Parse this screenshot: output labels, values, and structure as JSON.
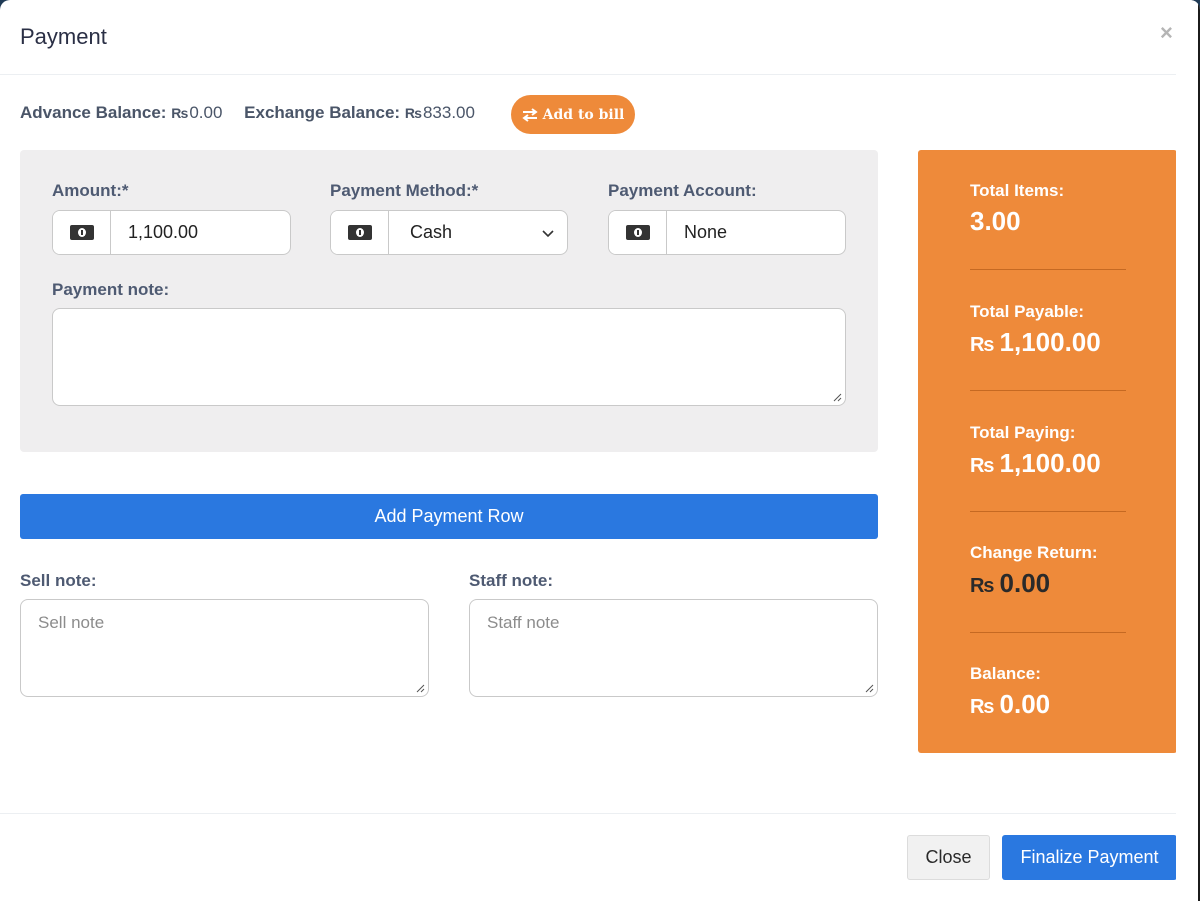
{
  "modal": {
    "title": "Payment"
  },
  "balances": {
    "advance_label": "Advance Balance:",
    "advance_currency": "₨",
    "advance_value": "0.00",
    "exchange_label": "Exchange Balance:",
    "exchange_currency": "₨",
    "exchange_value": "833.00",
    "add_to_bill_label": "Add to bill"
  },
  "payment_row": {
    "amount_label": "Amount:*",
    "amount_value": "1,100.00",
    "method_label": "Payment Method:*",
    "method_value": "Cash",
    "account_label": "Payment Account:",
    "account_value": "None",
    "note_label": "Payment note:",
    "note_value": ""
  },
  "add_payment_row_label": "Add Payment Row",
  "notes": {
    "sell_label": "Sell note:",
    "sell_placeholder": "Sell note",
    "staff_label": "Staff note:",
    "staff_placeholder": "Staff note"
  },
  "summary": {
    "currency": "₨",
    "total_items_label": "Total Items:",
    "total_items_value": "3.00",
    "total_payable_label": "Total Payable:",
    "total_payable_value": "1,100.00",
    "total_paying_label": "Total Paying:",
    "total_paying_value": "1,100.00",
    "change_return_label": "Change Return:",
    "change_return_value": "0.00",
    "balance_label": "Balance:",
    "balance_value": "0.00"
  },
  "footer": {
    "close_label": "Close",
    "finalize_label": "Finalize Payment"
  },
  "colors": {
    "accent_orange": "#ee8a3a",
    "primary_blue": "#2a78e0"
  },
  "icons": [
    "close-icon",
    "exchange-arrows-icon",
    "money-bill-icon",
    "chevron-down-icon",
    "resize-grip-icon"
  ]
}
